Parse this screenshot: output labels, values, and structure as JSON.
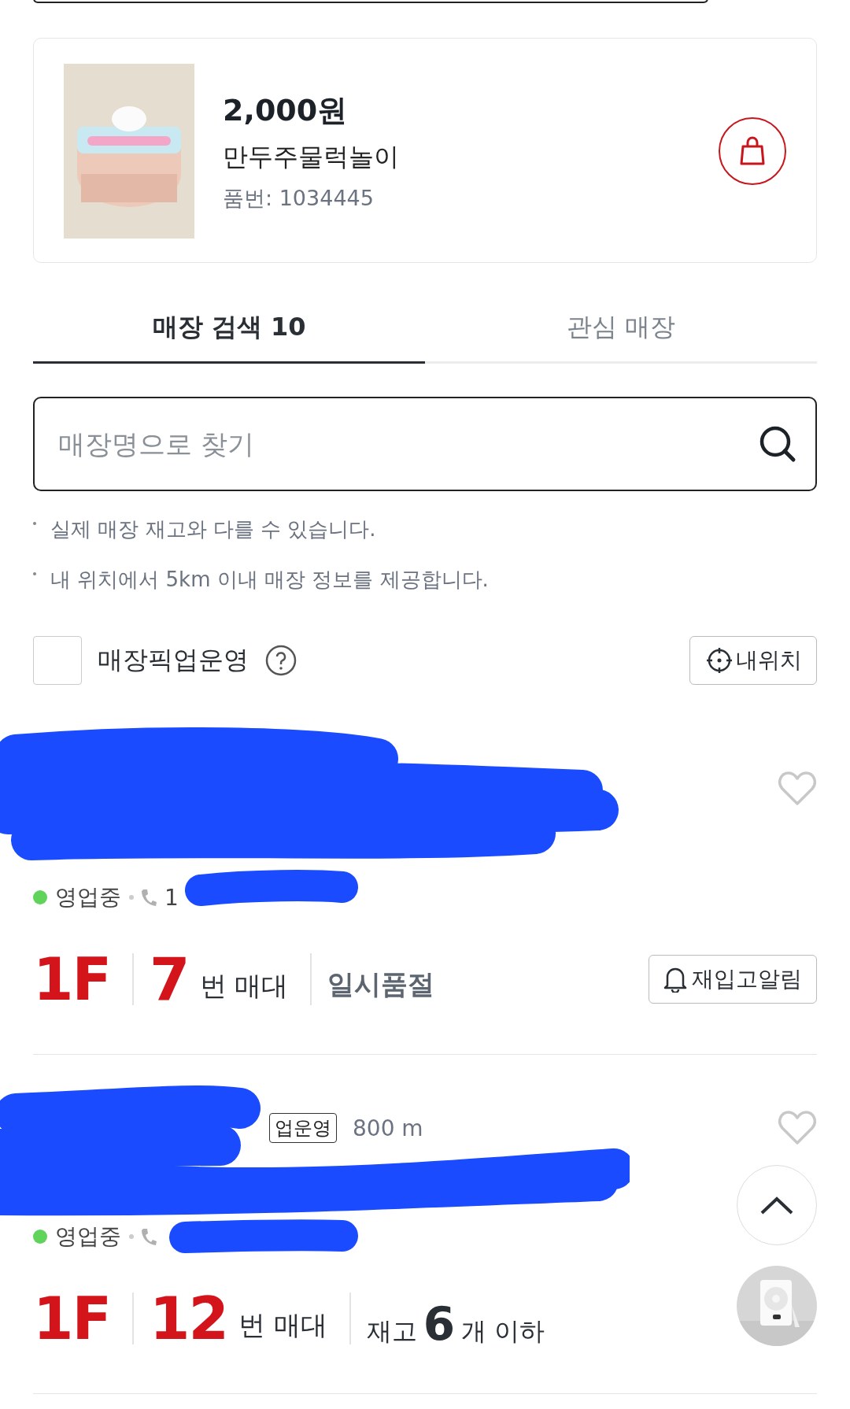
{
  "product": {
    "price": "2,000원",
    "name": "만두주물럭놀이",
    "item_no": "품번: 1034445"
  },
  "tabs": [
    {
      "label": "매장 검색 10",
      "selected": true
    },
    {
      "label": "관심 매장",
      "selected": false
    }
  ],
  "search": {
    "placeholder": "매장명으로 찾기"
  },
  "notes": [
    "실제 매장 재고와 다를 수 있습니다.",
    "내 위치에서 5km 이내 매장 정보를 제공합니다."
  ],
  "pickup_filter": {
    "label": "매장픽업운영",
    "checked": false
  },
  "location_button": "내위치",
  "stores": [
    {
      "favorite": false,
      "status": "영업중",
      "phone": "1",
      "floor": "1F",
      "shelf": "7",
      "shelf_suffix": "번 매대",
      "stock": {
        "kind": "soldout",
        "text": "일시품절"
      },
      "restock_button": "재입고알림"
    },
    {
      "badge": "업운영",
      "distance": "800 m",
      "favorite": false,
      "status": "영업중",
      "floor": "1F",
      "shelf": "12",
      "shelf_suffix": "번 매대",
      "stock": {
        "kind": "count",
        "prefix": "재고",
        "count": "6",
        "suffix": "개 이하"
      }
    }
  ]
}
